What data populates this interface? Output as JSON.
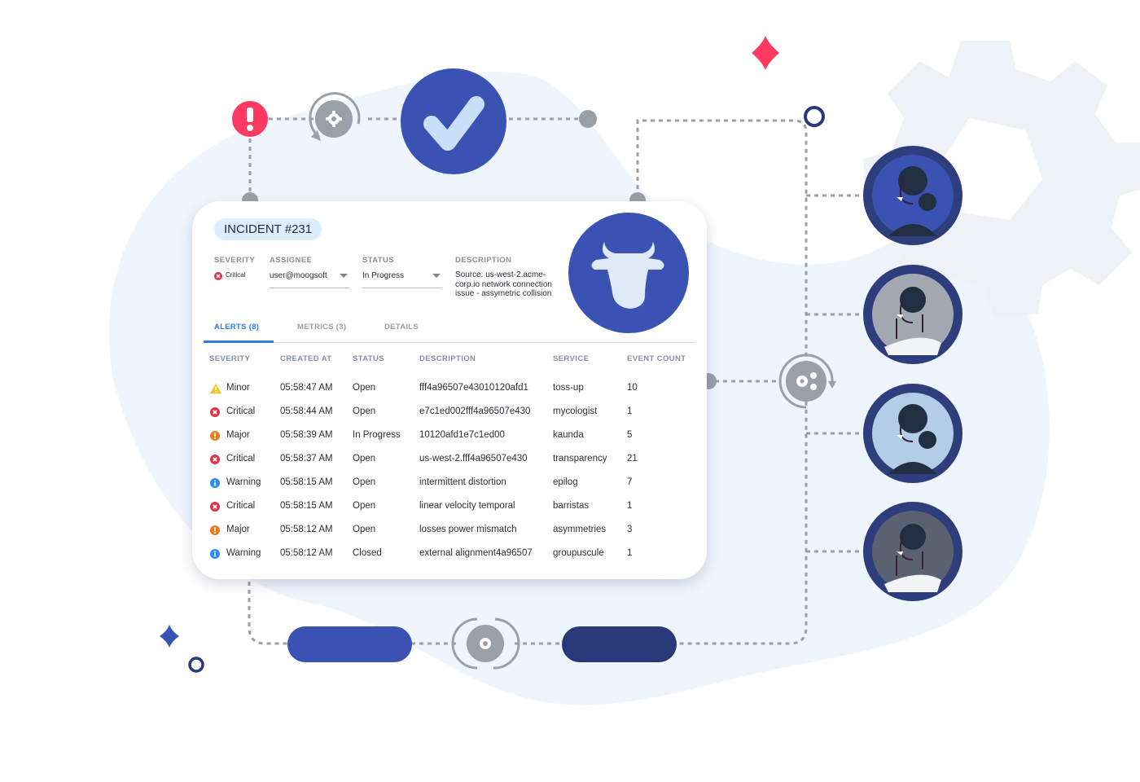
{
  "incident": {
    "title": "INCIDENT #231",
    "fields": {
      "severity_label": "SEVERITY",
      "severity_value": "Critical",
      "assignee_label": "ASSIGNEE",
      "assignee_value": "user@moogsoft",
      "status_label": "STATUS",
      "status_value": "In Progress",
      "description_label": "DESCRIPTION",
      "description_value": "Source: us-west-2.acme-corp.io network connection issue - assymetric collision"
    },
    "tabs": [
      {
        "label": "ALERTS (8)",
        "active": true
      },
      {
        "label": "METRICS (3)",
        "active": false
      },
      {
        "label": "DETAILS",
        "active": false
      }
    ],
    "table": {
      "headers": [
        "SEVERITY",
        "CREATED AT",
        "STATUS",
        "DESCRIPTION",
        "SERVICE",
        "EVENT COUNT"
      ],
      "rows": [
        {
          "severity": "Minor",
          "icon": "warning-triangle-icon",
          "created": "05:58:47 AM",
          "status": "Open",
          "description": "fff4a96507e43010120afd1",
          "service": "toss-up",
          "count": "10"
        },
        {
          "severity": "Critical",
          "icon": "critical-x-icon",
          "created": "05:58:44 AM",
          "status": "Open",
          "description": "e7c1ed002fff4a96507e430",
          "service": "mycologist",
          "count": "1"
        },
        {
          "severity": "Major",
          "icon": "major-exclamation-icon",
          "created": "05:58:39 AM",
          "status": "In Progress",
          "description": "10120afd1e7c1ed00",
          "service": "kaunda",
          "count": "5"
        },
        {
          "severity": "Critical",
          "icon": "critical-x-icon",
          "created": "05:58:37 AM",
          "status": "Open",
          "description": "us-west-2.fff4a96507e430",
          "service": "transparency",
          "count": "21"
        },
        {
          "severity": "Warning",
          "icon": "warning-info-icon",
          "created": "05:58:15 AM",
          "status": "Open",
          "description": "intermittent  distortion",
          "service": "epilog",
          "count": "7"
        },
        {
          "severity": "Critical",
          "icon": "critical-x-icon",
          "created": "05:58:15 AM",
          "status": "Open",
          "description": "linear velocity temporal",
          "service": "barristas",
          "count": "1"
        },
        {
          "severity": "Major",
          "icon": "major-exclamation-icon",
          "created": "05:58:12 AM",
          "status": "Open",
          "description": "losses power mismatch",
          "service": "asymmetries",
          "count": "3"
        },
        {
          "severity": "Warning",
          "icon": "warning-info-icon",
          "created": "05:58:12 AM",
          "status": "Closed",
          "description": "external alignment4a96507",
          "service": "groupuscule",
          "count": "1"
        }
      ]
    }
  },
  "colors": {
    "critical": "#d63649",
    "major": "#f07a1a",
    "minor": "#f5c518",
    "warning": "#2d8cf0",
    "accent": "#2b7de9",
    "brand_blue": "#3a53b3",
    "navy": "#283878",
    "alert_red": "#ff3a60",
    "connector_gray": "#9aa0a8"
  },
  "icons": [
    "alert-exclamation-icon",
    "gear-cycle-icon",
    "checkmark-icon",
    "cow-logo-icon",
    "gears-cycle-icon",
    "person-avatar-icon",
    "background-gear-icon"
  ]
}
